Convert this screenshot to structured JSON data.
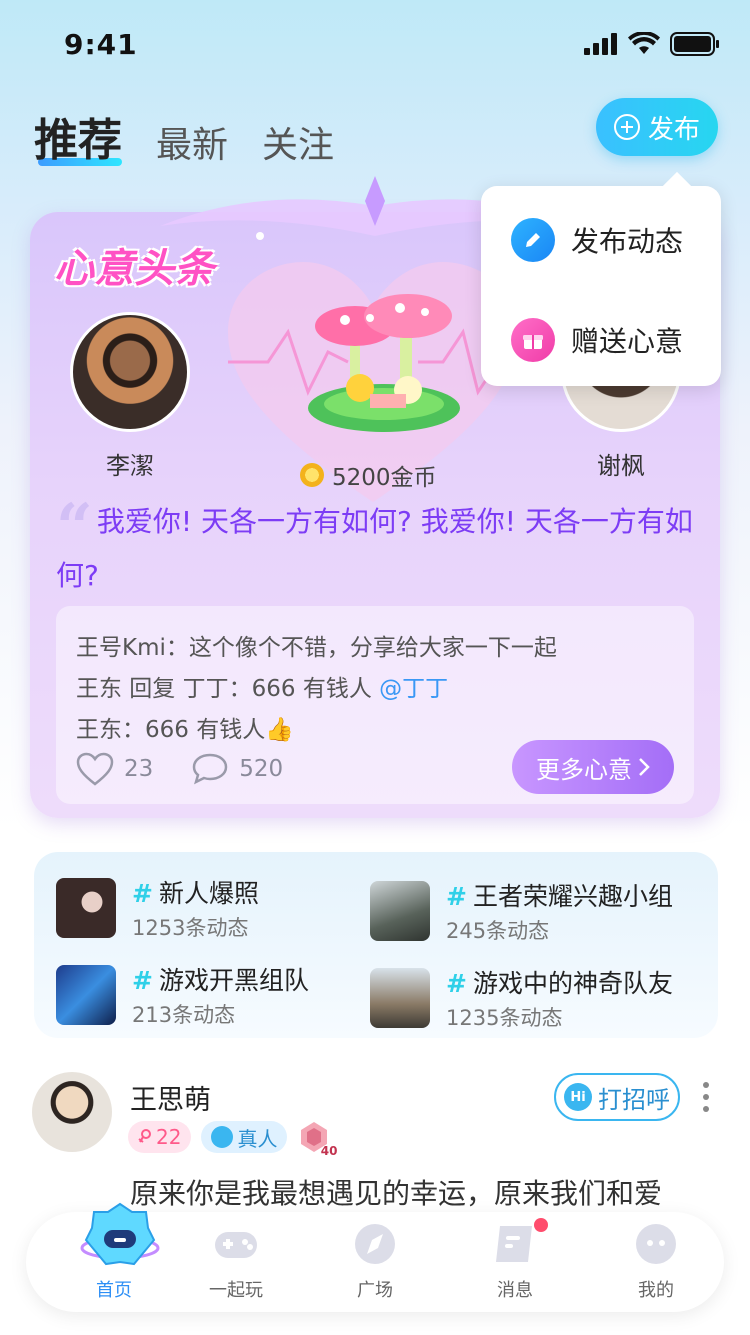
{
  "status_bar": {
    "time": "9:41"
  },
  "header": {
    "tabs": [
      {
        "label": "推荐",
        "active": true
      },
      {
        "label": "最新",
        "active": false
      },
      {
        "label": "关注",
        "active": false
      }
    ],
    "publish_label": "发布"
  },
  "dropdown": {
    "items": [
      {
        "label": "发布动态",
        "icon": "pencil-icon"
      },
      {
        "label": "赠送心意",
        "icon": "gift-icon"
      }
    ]
  },
  "feature_card": {
    "title": "心意头条",
    "sender": {
      "name": "李潔"
    },
    "receiver": {
      "name": "谢枫"
    },
    "gift_price": "5200金币",
    "quote": "我爱你! 天各一方有如何? 我爱你! 天各一方有如何?",
    "comments": [
      {
        "text": "王号Kmi：这个像个不错，分享给大家一下一起",
        "mention": ""
      },
      {
        "text": "王东 回复 丁丁：666 有钱人 ",
        "mention": "@丁丁"
      },
      {
        "text": "王东：666 有钱人👍",
        "mention": ""
      }
    ],
    "likes": "23",
    "comments_count": "520",
    "more_label": "更多心意"
  },
  "topics": [
    {
      "title": "新人爆照",
      "count": "1253条动态"
    },
    {
      "title": "王者荣耀兴趣小组",
      "count": "245条动态"
    },
    {
      "title": "游戏开黑组队",
      "count": "213条动态"
    },
    {
      "title": "游戏中的神奇队友",
      "count": "1235条动态"
    }
  ],
  "post": {
    "name": "王思萌",
    "age_badge": "22",
    "verified_label": "真人",
    "level": "40",
    "greet_label": "打招呼",
    "hi_text": "Hi",
    "text": "原来你是我最想遇见的幸运，原来我们和爱"
  },
  "bottom_nav": [
    {
      "label": "首页",
      "active": true
    },
    {
      "label": "一起玩",
      "active": false
    },
    {
      "label": "广场",
      "active": false
    },
    {
      "label": "消息",
      "active": false
    },
    {
      "label": "我的",
      "active": false
    }
  ],
  "colors": {
    "accent": "#2ec8f0",
    "purple": "#7d3cf5",
    "pink": "#ff52c4"
  }
}
